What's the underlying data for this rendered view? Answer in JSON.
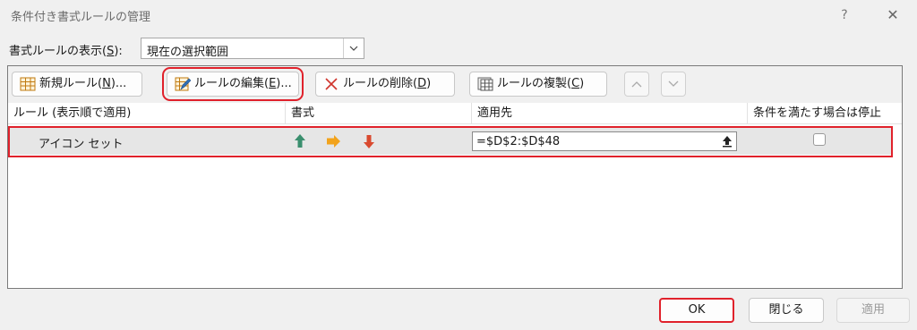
{
  "window": {
    "title": "条件付き書式ルールの管理",
    "help": "?",
    "close": "✕"
  },
  "scope": {
    "label_pre": "書式ルールの表示(",
    "label_key": "S",
    "label_post": "):",
    "value": "現在の選択範囲"
  },
  "toolbar": {
    "new_rule": {
      "pre": "新規ルール(",
      "key": "N",
      "post": ")..."
    },
    "edit_rule": {
      "pre": "ルールの編集(",
      "key": "E",
      "post": ")..."
    },
    "delete_rule": {
      "pre": "ルールの削除(",
      "key": "D",
      "post": ")"
    },
    "duplicate_rule": {
      "pre": "ルールの複製(",
      "key": "C",
      "post": ")"
    }
  },
  "columns": {
    "rule": "ルール (表示順で適用)",
    "format": "書式",
    "applies_to": "適用先",
    "stop_if_true": "条件を満たす場合は停止"
  },
  "rules": [
    {
      "name": "アイコン セット",
      "applies_to": "=$D$2:$D$48",
      "stop_if_true": false,
      "icons": [
        "green-up-arrow",
        "yellow-right-arrow",
        "red-down-arrow"
      ]
    }
  ],
  "buttons": {
    "ok": "OK",
    "close": "閉じる",
    "apply": "適用"
  },
  "colors": {
    "highlight": "#e0212b",
    "up": "#3a8f6e",
    "right": "#f2a31c",
    "down": "#d94a2f"
  }
}
